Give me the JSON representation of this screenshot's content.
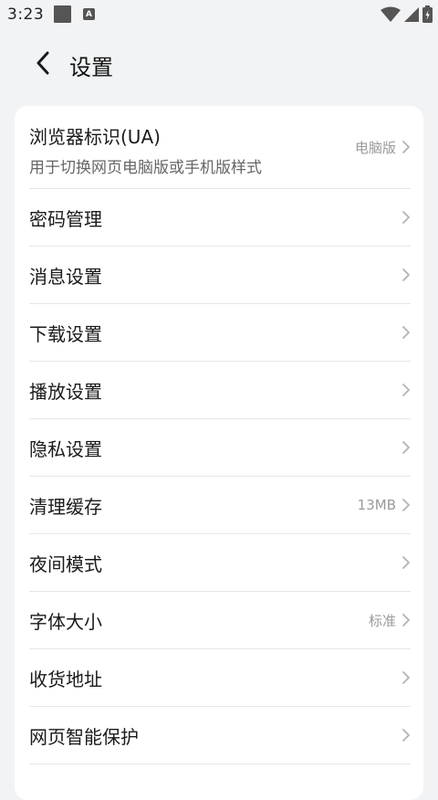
{
  "status_bar": {
    "time": "3:23",
    "icons": [
      "notification-square-icon",
      "a-badge-icon",
      "wifi-icon",
      "signal-icon",
      "battery-icon"
    ]
  },
  "header": {
    "back_icon": "chevron-left-icon",
    "title": "设置"
  },
  "settings": {
    "ua": {
      "title": "浏览器标识(UA)",
      "subtitle": "用于切换网页电脑版或手机版样式",
      "value": "电脑版"
    },
    "items": [
      {
        "label": "密码管理",
        "value": ""
      },
      {
        "label": "消息设置",
        "value": ""
      },
      {
        "label": "下载设置",
        "value": ""
      },
      {
        "label": "播放设置",
        "value": ""
      },
      {
        "label": "隐私设置",
        "value": ""
      },
      {
        "label": "清理缓存",
        "value": "13MB"
      },
      {
        "label": "夜间模式",
        "value": ""
      },
      {
        "label": "字体大小",
        "value": "标准"
      },
      {
        "label": "收货地址",
        "value": ""
      },
      {
        "label": "网页智能保护",
        "value": ""
      }
    ]
  },
  "colors": {
    "background": "#f1f3f5",
    "card": "#ffffff",
    "text": "#1a1a1a",
    "secondary_text": "#9a9a9a",
    "divider": "#e6e6e6"
  }
}
